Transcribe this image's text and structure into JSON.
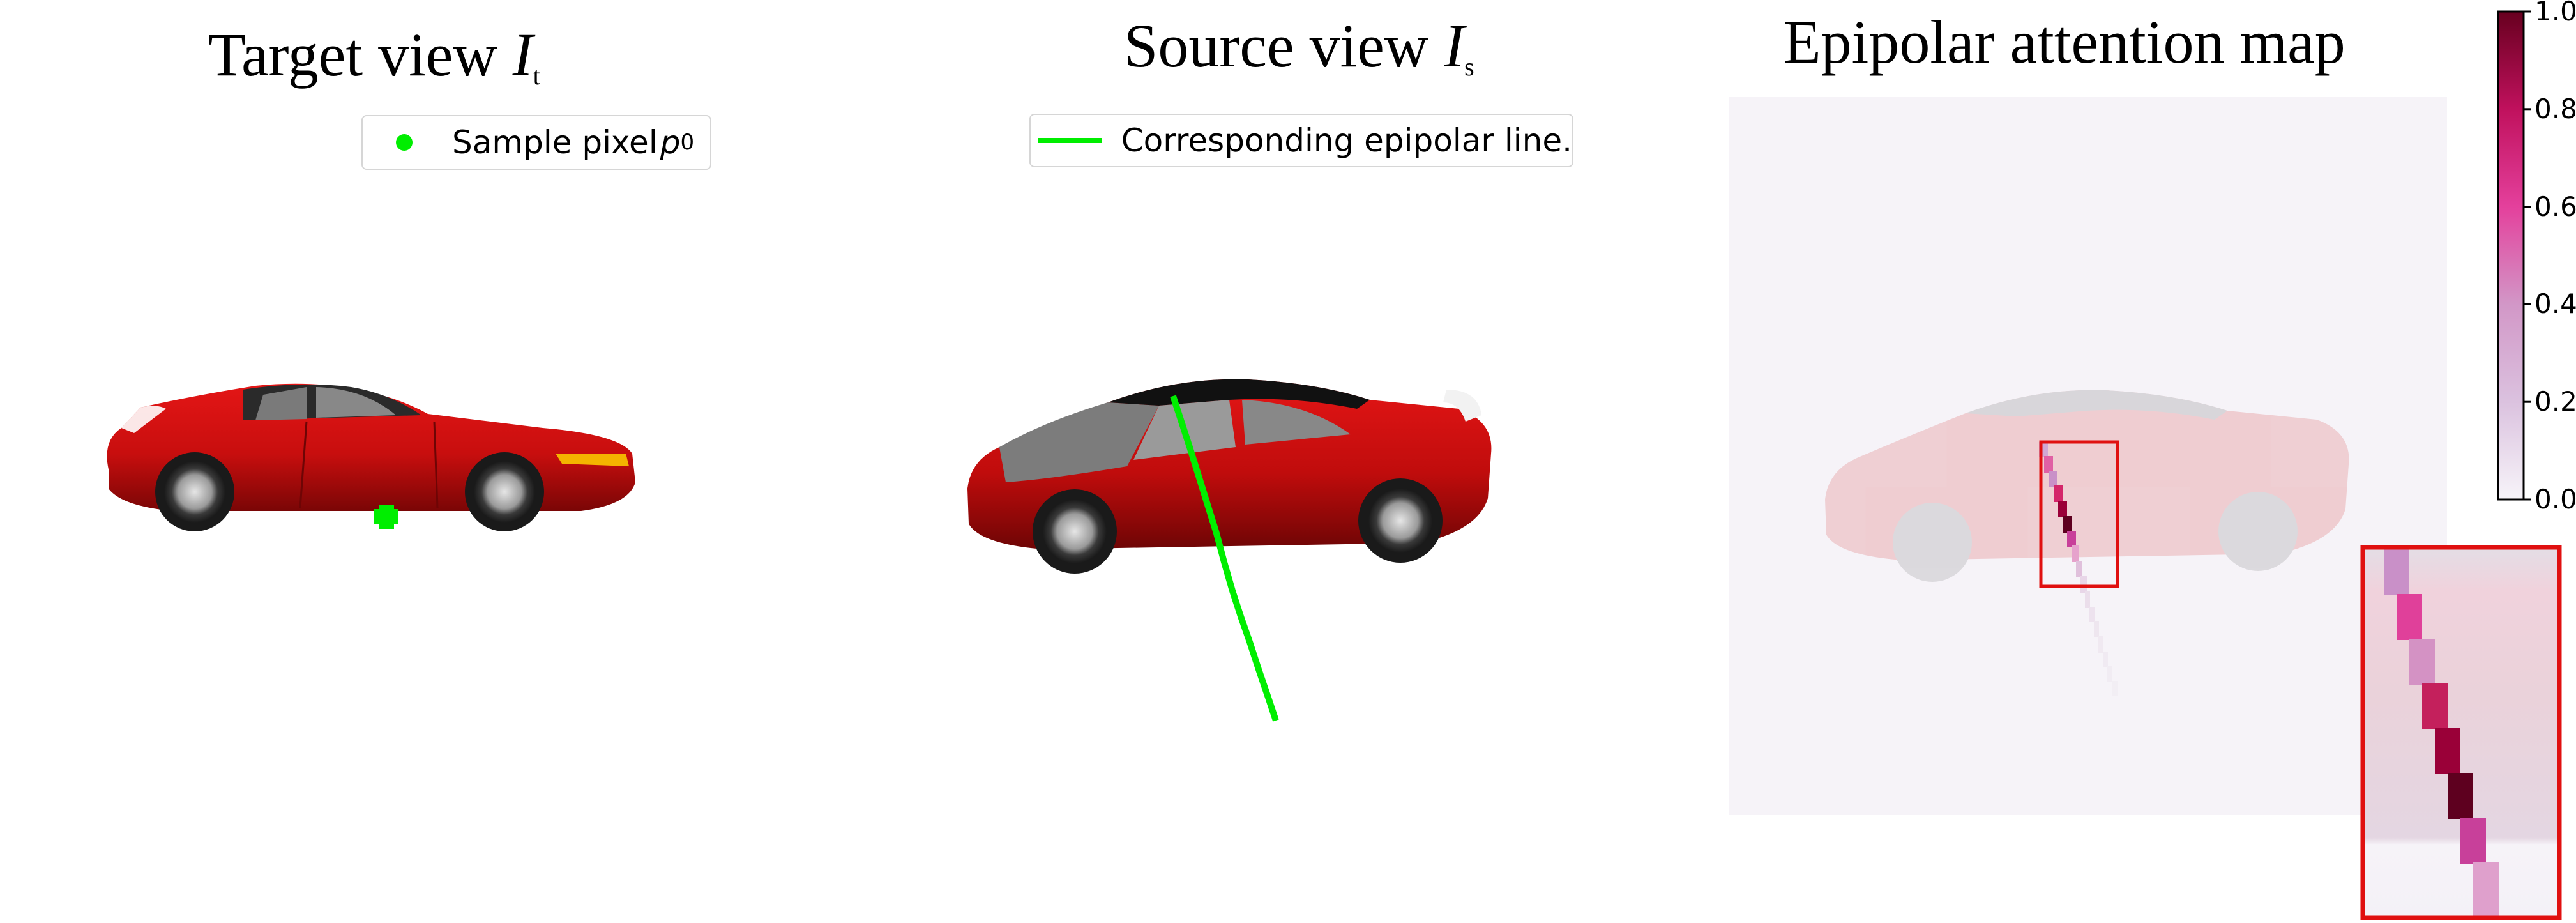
{
  "panels": {
    "target": {
      "title_text": "Target view ",
      "title_var": "I",
      "title_sub": "t"
    },
    "source": {
      "title_text": "Source view ",
      "title_var": "I",
      "title_sub": "s"
    },
    "attention": {
      "title": "Epipolar attention map"
    }
  },
  "legends": {
    "target": {
      "label": "Sample pixel ",
      "var": "p",
      "sub": "0",
      "marker": "circle",
      "color": "#00ee00"
    },
    "source": {
      "label": "Corresponding epipolar line.",
      "marker": "line",
      "color": "#00ee00"
    }
  },
  "colorbar": {
    "ticks": [
      "0.0",
      "0.2",
      "0.4",
      "0.6",
      "0.8",
      "1.0"
    ],
    "colormap": "PuRd",
    "range": [
      0.0,
      1.0
    ]
  },
  "colors": {
    "car_body": "#cc1010",
    "car_roof": "#2a2a2a",
    "sample_marker": "#00ee00",
    "zoom_box": "#e01010",
    "attention_background": "#f6f3f8"
  }
}
